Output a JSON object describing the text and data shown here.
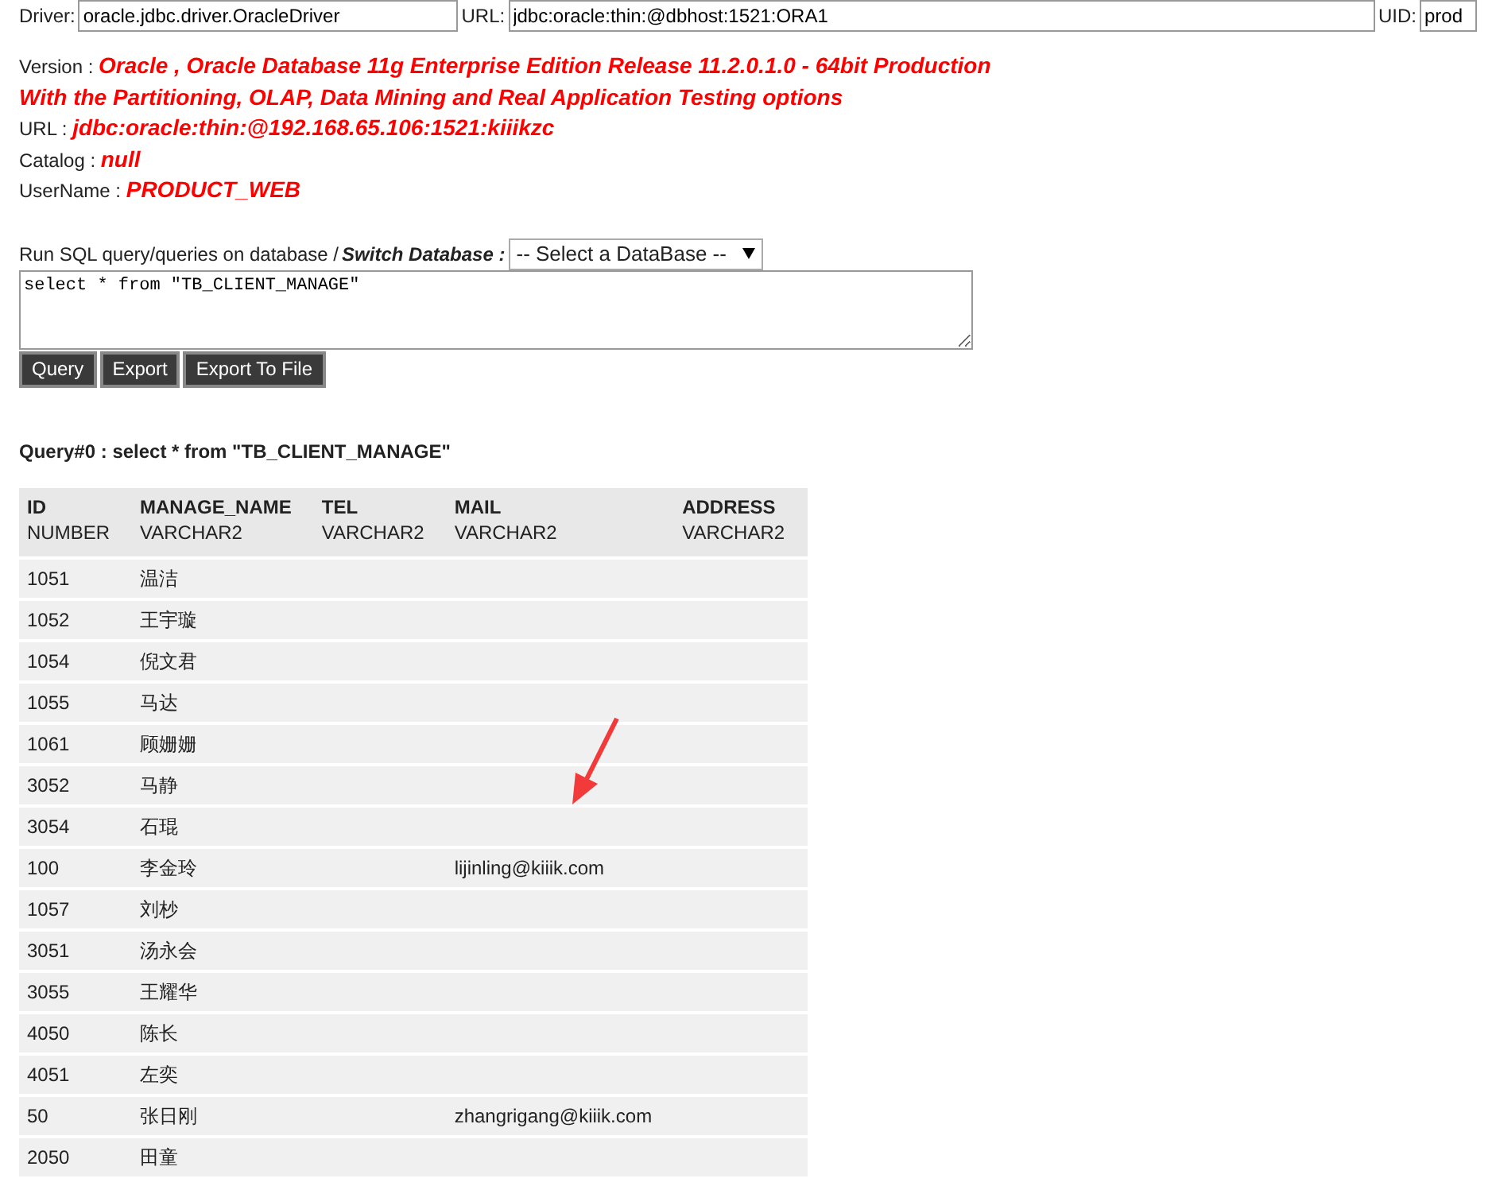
{
  "connection": {
    "driver_label": "Driver:",
    "driver_value": "oracle.jdbc.driver.OracleDriver",
    "url_label": "URL:",
    "url_value": "jdbc:oracle:thin:@dbhost:1521:ORA1",
    "uid_label": "UID:",
    "uid_value": "prod"
  },
  "info": [
    {
      "label": "Version :",
      "value": "Oracle , Oracle Database 11g Enterprise Edition Release 11.2.0.1.0 - 64bit Production With the Partitioning, OLAP, Data Mining and Real Application Testing options"
    },
    {
      "label": "URL :",
      "value": "jdbc:oracle:thin:@192.168.65.106:1521:kiiikzc"
    },
    {
      "label": "Catalog :",
      "value": "null"
    },
    {
      "label": "UserName :",
      "value": "PRODUCT_WEB"
    }
  ],
  "query_form": {
    "prompt": "Run SQL query/queries on database / ",
    "switch_label": "Switch Database :",
    "database_select": "-- Select a DataBase --",
    "sql": "select * from \"TB_CLIENT_MANAGE\"",
    "buttons": [
      "Query",
      "Export",
      "Export To File"
    ]
  },
  "result_title": "Query#0 : select * from \"TB_CLIENT_MANAGE\"",
  "table": {
    "columns": [
      {
        "name": "ID",
        "type": "NUMBER"
      },
      {
        "name": "MANAGE_NAME",
        "type": "VARCHAR2"
      },
      {
        "name": "TEL",
        "type": "VARCHAR2"
      },
      {
        "name": "MAIL",
        "type": "VARCHAR2"
      },
      {
        "name": "ADDRESS",
        "type": "VARCHAR2"
      }
    ],
    "rows": [
      [
        "1051",
        "温洁",
        "",
        "",
        ""
      ],
      [
        "1052",
        "王宇璇",
        "",
        "",
        ""
      ],
      [
        "1054",
        "倪文君",
        "",
        "",
        ""
      ],
      [
        "1055",
        "马达",
        "",
        "",
        ""
      ],
      [
        "1061",
        "顾姗姗",
        "",
        "",
        ""
      ],
      [
        "3052",
        "马静",
        "",
        "",
        ""
      ],
      [
        "3054",
        "石琨",
        "",
        "",
        ""
      ],
      [
        "100",
        "李金玲",
        "",
        "lijinling@kiiik.com",
        ""
      ],
      [
        "1057",
        "刘杪",
        "",
        "",
        ""
      ],
      [
        "3051",
        "汤永会",
        "",
        "",
        ""
      ],
      [
        "3055",
        "王耀华",
        "",
        "",
        ""
      ],
      [
        "4050",
        "陈长",
        "",
        "",
        ""
      ],
      [
        "4051",
        "左奕",
        "",
        "",
        ""
      ],
      [
        "50",
        "张日刚",
        "",
        "zhangrigang@kiiik.com",
        ""
      ],
      [
        "2050",
        "田童",
        "",
        "",
        ""
      ]
    ]
  }
}
